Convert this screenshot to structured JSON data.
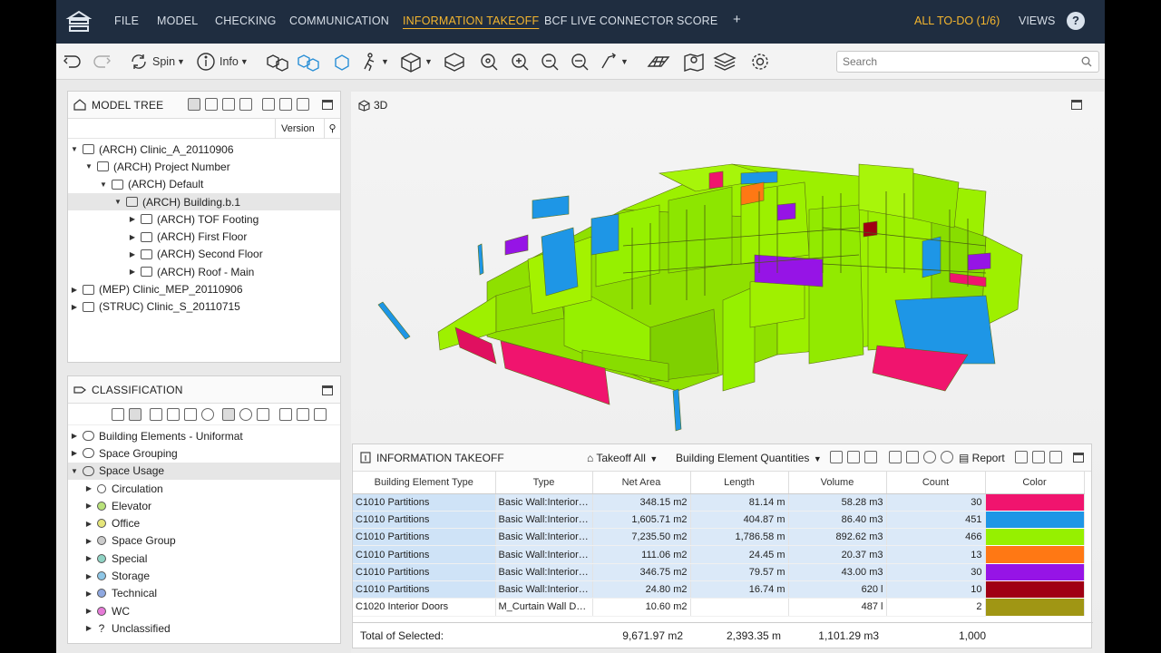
{
  "menu": {
    "items": [
      "FILE",
      "MODEL",
      "CHECKING",
      "COMMUNICATION",
      "INFORMATION TAKEOFF",
      "BCF LIVE CONNECTOR",
      "SCORE",
      "+"
    ],
    "active": "INFORMATION TAKEOFF",
    "todo": "ALL TO-DO (1/6)",
    "views": "VIEWS",
    "help": "?"
  },
  "toolbar": {
    "spin_label": "Spin",
    "info_label": "Info",
    "search_placeholder": "Search"
  },
  "model_tree": {
    "title": "MODEL TREE",
    "version_label": "Version",
    "rows": [
      {
        "label": "(ARCH) Clinic_A_20110906",
        "expanded": true
      },
      {
        "label": "(ARCH) Project Number",
        "expanded": true
      },
      {
        "label": "(ARCH) Default",
        "expanded": true
      },
      {
        "label": "(ARCH) Building.b.1",
        "expanded": true,
        "selected": true
      },
      {
        "label": "(ARCH) TOF Footing",
        "expanded": false
      },
      {
        "label": "(ARCH) First Floor",
        "expanded": false
      },
      {
        "label": "(ARCH) Second Floor",
        "expanded": false
      },
      {
        "label": "(ARCH) Roof - Main",
        "expanded": false
      },
      {
        "label": "(MEP) Clinic_MEP_20110906",
        "expanded": false
      },
      {
        "label": "(STRUC) Clinic_S_20110715",
        "expanded": false
      }
    ]
  },
  "classification": {
    "title": "CLASSIFICATION",
    "rows": [
      {
        "label": "Building Elements - Uniformat"
      },
      {
        "label": "Space Grouping"
      },
      {
        "label": "Space Usage",
        "selected": true
      },
      {
        "label": "Circulation",
        "color": "#ffffff"
      },
      {
        "label": "Elevator",
        "color": "#b9e27a"
      },
      {
        "label": "Office",
        "color": "#e6e67a"
      },
      {
        "label": "Space Group",
        "color": "#cccccc"
      },
      {
        "label": "Special",
        "color": "#8fd3c4"
      },
      {
        "label": "Storage",
        "color": "#8ec6e6"
      },
      {
        "label": "Technical",
        "color": "#8fa8e0"
      },
      {
        "label": "WC",
        "color": "#e67ad7"
      },
      {
        "label": "Unclassified",
        "color": "?"
      }
    ]
  },
  "viewport": {
    "label": "3D"
  },
  "takeoff": {
    "title": "INFORMATION TAKEOFF",
    "takeoff_all": "Takeoff All",
    "quantities": "Building Element Quantities",
    "report": "Report",
    "columns": [
      "Building Element Type",
      "Type",
      "Net Area",
      "Length",
      "Volume",
      "Count",
      "Color"
    ],
    "rows": [
      {
        "bet": "C1010 Partitions",
        "type": "Basic Wall:Interior ...",
        "area": "348.15 m2",
        "length": "81.14 m",
        "volume": "58.28 m3",
        "count": "30",
        "color": "#f0146e",
        "sel": true
      },
      {
        "bet": "C1010 Partitions",
        "type": "Basic Wall:Interior ...",
        "area": "1,605.71 m2",
        "length": "404.87 m",
        "volume": "86.40 m3",
        "count": "451",
        "color": "#1e96e6",
        "sel": true
      },
      {
        "bet": "C1010 Partitions",
        "type": "Basic Wall:Interior ...",
        "area": "7,235.50 m2",
        "length": "1,786.58 m",
        "volume": "892.62 m3",
        "count": "466",
        "color": "#96f000",
        "sel": true
      },
      {
        "bet": "C1010 Partitions",
        "type": "Basic Wall:Interior ...",
        "area": "111.06 m2",
        "length": "24.45 m",
        "volume": "20.37 m3",
        "count": "13",
        "color": "#ff7814",
        "sel": true
      },
      {
        "bet": "C1010 Partitions",
        "type": "Basic Wall:Interior ...",
        "area": "346.75 m2",
        "length": "79.57 m",
        "volume": "43.00 m3",
        "count": "30",
        "color": "#9614e6",
        "sel": true
      },
      {
        "bet": "C1010 Partitions",
        "type": "Basic Wall:Interior ...",
        "area": "24.80 m2",
        "length": "16.74 m",
        "volume": "620 l",
        "count": "10",
        "color": "#a00014",
        "sel": true
      },
      {
        "bet": "C1020 Interior Doors",
        "type": "M_Curtain Wall Db...",
        "area": "10.60 m2",
        "length": "",
        "volume": "487 l",
        "count": "2",
        "color": "#a09614",
        "sel": false
      }
    ],
    "total": {
      "label": "Total of Selected:",
      "area": "9,671.97 m2",
      "length": "2,393.35 m",
      "volume": "1,101.29 m3",
      "count": "1,000"
    }
  }
}
